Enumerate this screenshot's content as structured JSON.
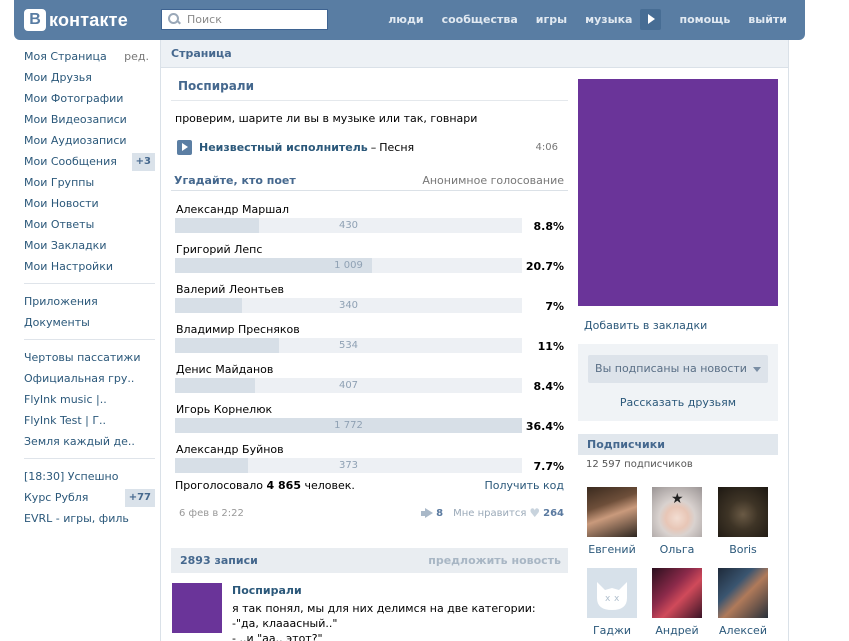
{
  "header": {
    "logo_letter": "В",
    "logo_text": "контакте",
    "search_placeholder": "Поиск",
    "nav": [
      "люди",
      "сообщества",
      "игры",
      "музыка",
      "помощь",
      "выйти"
    ]
  },
  "sidebar": {
    "edit_label": "ред.",
    "group1": [
      {
        "label": "Моя Страница"
      },
      {
        "label": "Мои Друзья"
      },
      {
        "label": "Мои Фотографии"
      },
      {
        "label": "Мои Видеозаписи"
      },
      {
        "label": "Мои Аудиозаписи"
      },
      {
        "label": "Мои Сообщения",
        "count": "+3"
      },
      {
        "label": "Мои Группы"
      },
      {
        "label": "Мои Новости"
      },
      {
        "label": "Мои Ответы"
      },
      {
        "label": "Мои Закладки"
      },
      {
        "label": "Мои Настройки"
      }
    ],
    "group2": [
      {
        "label": "Приложения"
      },
      {
        "label": "Документы"
      }
    ],
    "group3": [
      {
        "label": "Чертовы пассатижи"
      },
      {
        "label": "Официальная гру.."
      },
      {
        "label": "FlyInk music |.."
      },
      {
        "label": "FlyInk Test | Г.."
      },
      {
        "label": "Земля каждый де.."
      }
    ],
    "group4": [
      {
        "label": "[18:30] Успешно"
      },
      {
        "label": "Курс Рубля",
        "count": "+77"
      },
      {
        "label": "EVRL - игры, филь"
      }
    ]
  },
  "breadcrumb": "Страница",
  "pinned": {
    "title": "Поспирали",
    "text": "проверим, шарите ли вы в музыке или так, говнари",
    "audio": {
      "artist": "Неизвестный исполнитель",
      "dash": "–",
      "title": "Песня",
      "duration": "4:06"
    }
  },
  "poll": {
    "question": "Угадайте, кто поет",
    "type": "Анонимное голосование",
    "options": [
      {
        "name": "Александр Маршал",
        "votes": "430",
        "percent": "8.8%",
        "fraction": 0.242
      },
      {
        "name": "Григорий Лепс",
        "votes": "1 009",
        "percent": "20.7%",
        "fraction": 0.569
      },
      {
        "name": "Валерий Леонтьев",
        "votes": "340",
        "percent": "7%",
        "fraction": 0.192
      },
      {
        "name": "Владимир Пресняков",
        "votes": "534",
        "percent": "11%",
        "fraction": 0.301
      },
      {
        "name": "Денис Майданов",
        "votes": "407",
        "percent": "8.4%",
        "fraction": 0.23
      },
      {
        "name": "Игорь Корнелюк",
        "votes": "1 772",
        "percent": "36.4%",
        "fraction": 1.0
      },
      {
        "name": "Александр Буйнов",
        "votes": "373",
        "percent": "7.7%",
        "fraction": 0.21
      }
    ],
    "total_prefix": "Проголосовало",
    "total": "4 865",
    "total_suffix": "человек.",
    "get_code": "Получить код"
  },
  "post_meta": {
    "date": "6 фев в 2:22",
    "shares": "8",
    "like_label": "Мне нравится",
    "likes": "264"
  },
  "wall": {
    "count_label": "2893 записи",
    "suggest": "предложить новость"
  },
  "post2": {
    "author": "Поспирали",
    "lines": [
      "я так понял, мы для них делимся на две категории:",
      "-\"да, клааасный..\"",
      "- ..и \"аа.. этот?\""
    ]
  },
  "right": {
    "bookmark": "Добавить в закладки",
    "subscribed": "Вы подписаны на новости",
    "tell_friends": "Рассказать друзьям",
    "subscribers_title": "Подписчики",
    "subscribers_count": "12 597 подписчиков",
    "subscribers": [
      {
        "name": "Евгений"
      },
      {
        "name": "Ольга"
      },
      {
        "name": "Boris"
      },
      {
        "name": "Гаджи"
      },
      {
        "name": "Андрей"
      },
      {
        "name": "Алексей"
      }
    ]
  },
  "colors": {
    "header": "#597da3",
    "link": "#2b587a",
    "accent_purple": "#6a3499"
  }
}
